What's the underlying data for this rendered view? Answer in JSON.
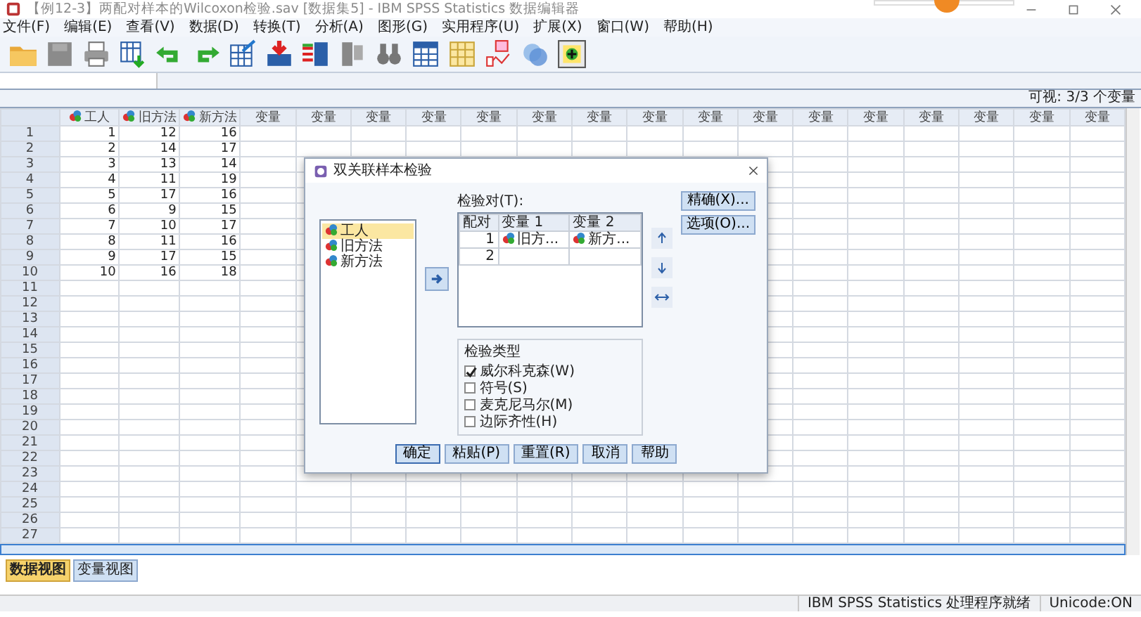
{
  "window": {
    "title": "【例12-3】两配对样本的Wilcoxon检验.sav [数据集5] - IBM SPSS Statistics 数据编辑器"
  },
  "menu": [
    {
      "label": "文件(F)"
    },
    {
      "label": "编辑(E)"
    },
    {
      "label": "查看(V)"
    },
    {
      "label": "数据(D)"
    },
    {
      "label": "转换(T)"
    },
    {
      "label": "分析(A)"
    },
    {
      "label": "图形(G)"
    },
    {
      "label": "实用程序(U)"
    },
    {
      "label": "扩展(X)"
    },
    {
      "label": "窗口(W)"
    },
    {
      "label": "帮助(H)"
    }
  ],
  "visible_variables": "可视: 3/3 个变量",
  "table": {
    "columns": [
      {
        "label": "工人",
        "kind": "variable"
      },
      {
        "label": "旧方法",
        "kind": "variable"
      },
      {
        "label": "新方法",
        "kind": "variable"
      },
      {
        "label": "变量",
        "kind": "empty"
      },
      {
        "label": "变量",
        "kind": "empty"
      },
      {
        "label": "变量",
        "kind": "empty"
      },
      {
        "label": "变量",
        "kind": "empty"
      },
      {
        "label": "变量",
        "kind": "empty"
      },
      {
        "label": "变量",
        "kind": "empty"
      },
      {
        "label": "变量",
        "kind": "empty"
      },
      {
        "label": "变量",
        "kind": "empty"
      },
      {
        "label": "变量",
        "kind": "empty"
      },
      {
        "label": "变量",
        "kind": "empty"
      },
      {
        "label": "变量",
        "kind": "empty"
      },
      {
        "label": "变量",
        "kind": "empty"
      },
      {
        "label": "变量",
        "kind": "empty"
      },
      {
        "label": "变量",
        "kind": "empty"
      },
      {
        "label": "变量",
        "kind": "empty"
      },
      {
        "label": "变量",
        "kind": "empty"
      }
    ],
    "rows": [
      {
        "number": "1",
        "cells": [
          "1",
          "12",
          "16"
        ]
      },
      {
        "number": "2",
        "cells": [
          "2",
          "14",
          "17"
        ]
      },
      {
        "number": "3",
        "cells": [
          "3",
          "13",
          "14"
        ]
      },
      {
        "number": "4",
        "cells": [
          "4",
          "11",
          "19"
        ]
      },
      {
        "number": "5",
        "cells": [
          "5",
          "17",
          "16"
        ]
      },
      {
        "number": "6",
        "cells": [
          "6",
          "9",
          "15"
        ]
      },
      {
        "number": "7",
        "cells": [
          "7",
          "10",
          "17"
        ]
      },
      {
        "number": "8",
        "cells": [
          "8",
          "11",
          "16"
        ]
      },
      {
        "number": "9",
        "cells": [
          "9",
          "17",
          "15"
        ]
      },
      {
        "number": "10",
        "cells": [
          "10",
          "16",
          "18"
        ]
      },
      {
        "number": "11"
      },
      {
        "number": "12"
      },
      {
        "number": "13"
      },
      {
        "number": "14"
      },
      {
        "number": "15"
      },
      {
        "number": "16"
      },
      {
        "number": "17"
      },
      {
        "number": "18"
      },
      {
        "number": "19"
      },
      {
        "number": "20"
      },
      {
        "number": "21"
      },
      {
        "number": "22"
      },
      {
        "number": "23"
      },
      {
        "number": "24"
      },
      {
        "number": "25"
      },
      {
        "number": "26"
      },
      {
        "number": "27"
      }
    ]
  },
  "dialog": {
    "title": "双关联样本检验",
    "source_list": [
      {
        "label": "工人",
        "selected": true
      },
      {
        "label": "旧方法",
        "selected": false
      },
      {
        "label": "新方法",
        "selected": false
      }
    ],
    "pairs_label": "检验对(T):",
    "pairs_columns": [
      "配对",
      "变量 1",
      "变量 2"
    ],
    "pairs": [
      {
        "pair": "1",
        "variable_1": "旧方...",
        "variable_2": "新方..."
      },
      {
        "pair": "2"
      }
    ],
    "test_type": {
      "title": "检验类型",
      "options": [
        {
          "label": "威尔科克森(W)",
          "checked": true
        },
        {
          "label": "符号(S)",
          "checked": false
        },
        {
          "label": "麦克尼马尔(M)",
          "checked": false
        },
        {
          "label": "边际齐性(H)",
          "checked": false
        }
      ]
    },
    "side_buttons": [
      "精确(X)...",
      "选项(O)..."
    ],
    "buttons": [
      {
        "label": "确定",
        "kind": "default"
      },
      {
        "label": "粘贴(P)",
        "kind": "normal"
      },
      {
        "label": "重置(R)",
        "kind": "normal"
      },
      {
        "label": "取消",
        "kind": "normal"
      },
      {
        "label": "帮助",
        "kind": "normal"
      }
    ]
  },
  "view_tabs": [
    {
      "label": "数据视图",
      "selected": true
    },
    {
      "label": "变量视图",
      "selected": false
    }
  ],
  "status_bar": [
    "IBM SPSS Statistics 处理程序就绪",
    "Unicode:ON"
  ]
}
